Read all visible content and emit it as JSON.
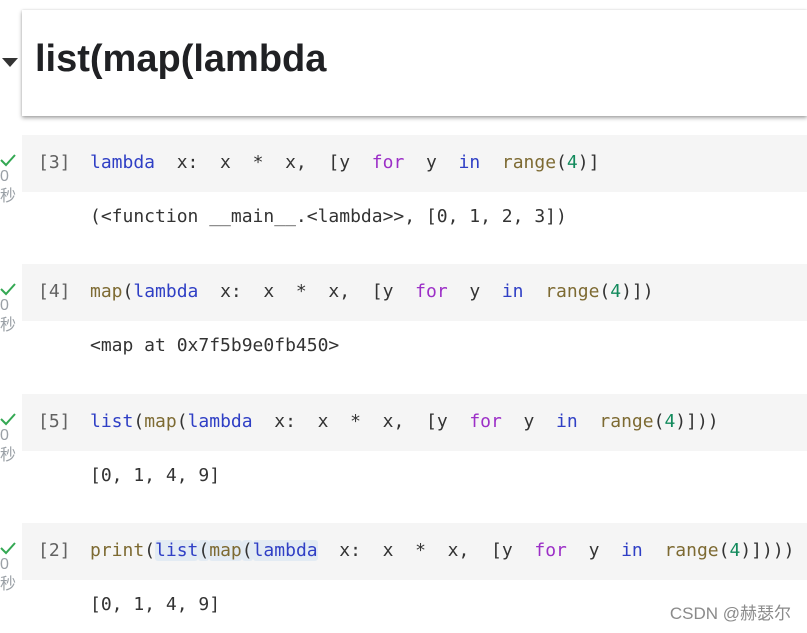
{
  "heading": "list(map(lambda",
  "gutter_time_value": "0",
  "gutter_time_unit": "秒",
  "cells": [
    {
      "exec_count": "[3]",
      "tokens": [
        {
          "t": "lambda",
          "c": "kw"
        },
        {
          "t": "  x:  x  *  x,  ["
        },
        {
          "t": "y  "
        },
        {
          "t": "for",
          "c": "op"
        },
        {
          "t": "  y  "
        },
        {
          "t": "in",
          "c": "kw"
        },
        {
          "t": "  "
        },
        {
          "t": "range",
          "c": "fn"
        },
        {
          "t": "("
        },
        {
          "t": "4",
          "c": "num"
        },
        {
          "t": ")]"
        }
      ],
      "output": "(<function __main__.<lambda>>, [0, 1, 2, 3])"
    },
    {
      "exec_count": "[4]",
      "tokens": [
        {
          "t": "map",
          "c": "fn"
        },
        {
          "t": "("
        },
        {
          "t": "lambda",
          "c": "kw"
        },
        {
          "t": "  x:  x  *  x,  [y  "
        },
        {
          "t": "for",
          "c": "op"
        },
        {
          "t": "  y  "
        },
        {
          "t": "in",
          "c": "kw"
        },
        {
          "t": "  "
        },
        {
          "t": "range",
          "c": "fn"
        },
        {
          "t": "("
        },
        {
          "t": "4",
          "c": "num"
        },
        {
          "t": ")])"
        }
      ],
      "output": "<map at 0x7f5b9e0fb450>"
    },
    {
      "exec_count": "[5]",
      "tokens": [
        {
          "t": "list",
          "c": "kw"
        },
        {
          "t": "("
        },
        {
          "t": "map",
          "c": "fn"
        },
        {
          "t": "("
        },
        {
          "t": "lambda",
          "c": "kw"
        },
        {
          "t": "  x:  x  *  x,  [y  "
        },
        {
          "t": "for",
          "c": "op"
        },
        {
          "t": "  y  "
        },
        {
          "t": "in",
          "c": "kw"
        },
        {
          "t": "  "
        },
        {
          "t": "range",
          "c": "fn"
        },
        {
          "t": "("
        },
        {
          "t": "4",
          "c": "num"
        },
        {
          "t": ")]))"
        }
      ],
      "output": "[0, 1, 4, 9]"
    },
    {
      "exec_count": "[2]",
      "tokens": [
        {
          "t": "print",
          "c": "fn"
        },
        {
          "t": "("
        },
        {
          "t": "list",
          "c": "kw",
          "hl": true
        },
        {
          "t": "(",
          "hl": true
        },
        {
          "t": "map",
          "c": "fn",
          "hl": true
        },
        {
          "t": "(",
          "hl": true
        },
        {
          "t": "lambda",
          "c": "kw",
          "hl": true
        },
        {
          "t": "  x:  x  *  x,  [y  "
        },
        {
          "t": "for",
          "c": "op"
        },
        {
          "t": "  y  "
        },
        {
          "t": "in",
          "c": "kw"
        },
        {
          "t": "  "
        },
        {
          "t": "range",
          "c": "fn"
        },
        {
          "t": "("
        },
        {
          "t": "4",
          "c": "num"
        },
        {
          "t": ")])))"
        }
      ],
      "output": "[0, 1, 4, 9]"
    }
  ],
  "watermark": "CSDN @赫瑟尔",
  "colors": {
    "keyword": "#2f3fc5",
    "operator_keyword": "#9c2fc7",
    "builtin": "#7d6a32",
    "number": "#128a5c",
    "check": "#34a853"
  }
}
